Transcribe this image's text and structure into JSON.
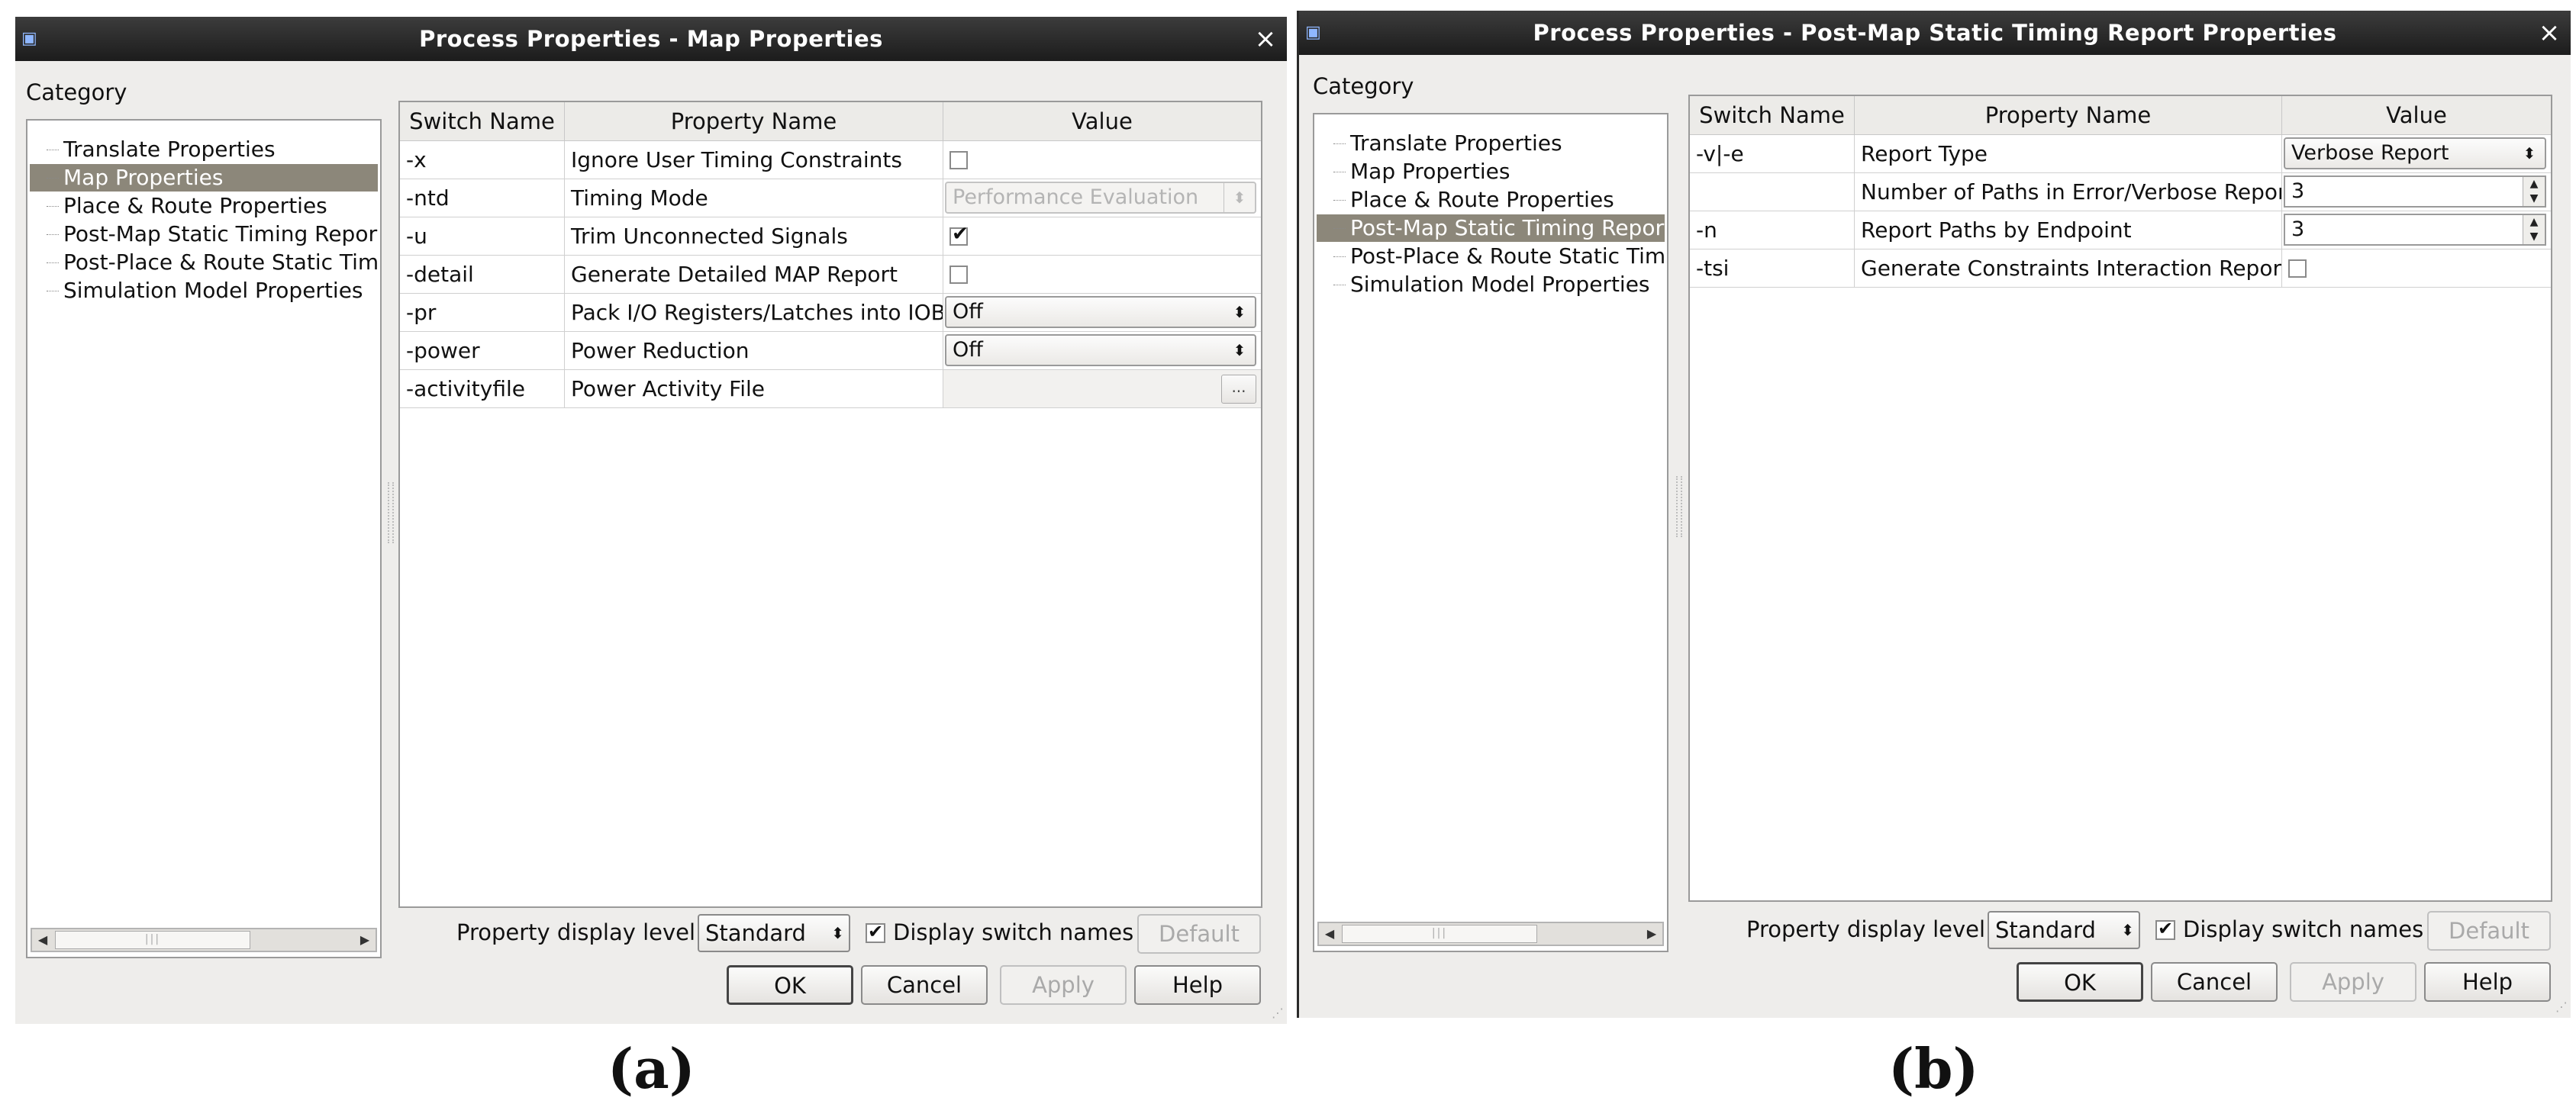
{
  "panels": {
    "a": {
      "caption": "(a)",
      "title": "Process Properties - Map Properties",
      "category_label": "Category",
      "tree": [
        "Translate Properties",
        "Map Properties",
        "Place & Route Properties",
        "Post-Map Static Timing Report",
        "Post-Place & Route Static Timi",
        "Simulation Model Properties"
      ],
      "selected_index": 1,
      "columns": [
        "Switch Name",
        "Property Name",
        "Value"
      ],
      "rows": [
        {
          "switch": "-x",
          "property": "Ignore User Timing Constraints",
          "value_type": "checkbox",
          "checked": false
        },
        {
          "switch": "-ntd",
          "property": "Timing Mode",
          "value_type": "combo-disabled",
          "value": "Performance Evaluation"
        },
        {
          "switch": "-u",
          "property": "Trim Unconnected Signals",
          "value_type": "checkbox",
          "checked": true
        },
        {
          "switch": "-detail",
          "property": "Generate Detailed MAP Report",
          "value_type": "checkbox",
          "checked": false
        },
        {
          "switch": "-pr",
          "property": "Pack I/O Registers/Latches into IOBs",
          "value_type": "combo",
          "value": "Off"
        },
        {
          "switch": "-power",
          "property": "Power Reduction",
          "value_type": "combo",
          "value": "Off"
        },
        {
          "switch": "-activityfile",
          "property": "Power Activity File",
          "value_type": "file",
          "value": "",
          "browse_label": "..."
        }
      ],
      "display_level_label": "Property display level:",
      "display_level_value": "Standard",
      "display_switch_names_label": "Display switch names",
      "display_switch_names_checked": true,
      "buttons": {
        "default": "Default",
        "ok": "OK",
        "cancel": "Cancel",
        "apply": "Apply",
        "help": "Help"
      }
    },
    "b": {
      "caption": "(b)",
      "title": "Process Properties - Post-Map Static Timing Report Properties",
      "category_label": "Category",
      "tree": [
        "Translate Properties",
        "Map Properties",
        "Place & Route Properties",
        "Post-Map Static Timing Report",
        "Post-Place & Route Static Timi",
        "Simulation Model Properties"
      ],
      "selected_index": 3,
      "columns": [
        "Switch Name",
        "Property Name",
        "Value"
      ],
      "rows": [
        {
          "switch": "-v|-e",
          "property": "Report Type",
          "value_type": "combo",
          "value": "Verbose Report"
        },
        {
          "switch": "",
          "property": "Number of Paths in Error/Verbose Report",
          "value_type": "spin",
          "value": "3"
        },
        {
          "switch": "-n",
          "property": "Report Paths by Endpoint",
          "value_type": "spin",
          "value": "3"
        },
        {
          "switch": "-tsi",
          "property": "Generate Constraints Interaction Report",
          "value_type": "checkbox",
          "checked": false
        }
      ],
      "display_level_label": "Property display level:",
      "display_level_value": "Standard",
      "display_switch_names_label": "Display switch names",
      "display_switch_names_checked": true,
      "buttons": {
        "default": "Default",
        "ok": "OK",
        "cancel": "Cancel",
        "apply": "Apply",
        "help": "Help"
      }
    }
  },
  "icons": {
    "window": "window-icon",
    "close": "close-icon",
    "combo_arrows": "up-down-arrows-icon",
    "check": "checkmark-icon"
  }
}
